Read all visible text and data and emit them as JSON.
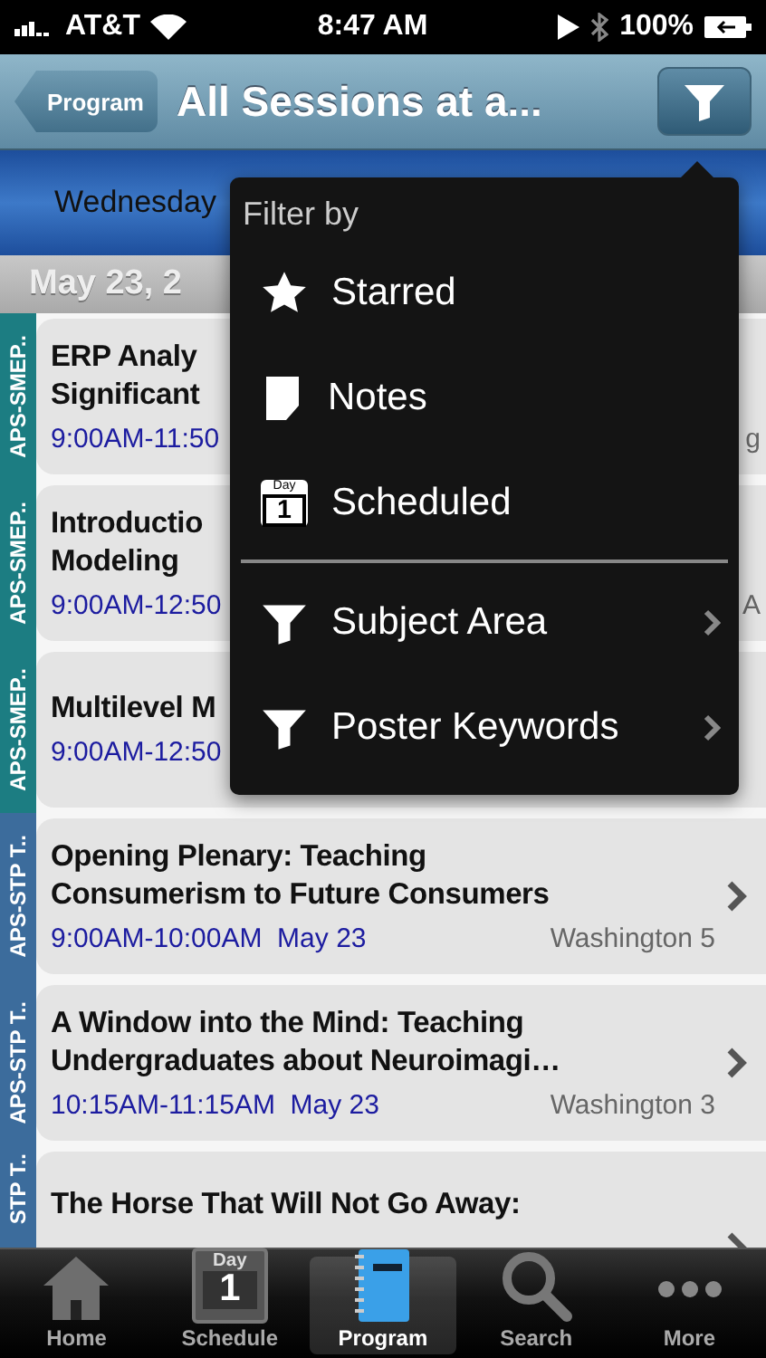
{
  "status_bar": {
    "carrier": "AT&T",
    "time": "8:47 AM",
    "battery": "100%"
  },
  "nav_bar": {
    "back": "Program",
    "title": "All Sessions at a..."
  },
  "day_strip": {
    "day": "Wednesday"
  },
  "date_header": "May 23, 2",
  "sessions": [
    {
      "tag": "APS-SMEP..",
      "color": "#1c7d82",
      "title_lines": [
        "ERP Analy",
        "Significant"
      ],
      "time": "9:00AM-11:50",
      "location": "g"
    },
    {
      "tag": "APS-SMEP..",
      "color": "#1c7d82",
      "title_lines": [
        "Introductio",
        "Modeling"
      ],
      "time": "9:00AM-12:50",
      "location": "A"
    },
    {
      "tag": "APS-SMEP..",
      "color": "#1c7d82",
      "title_lines": [
        "Multilevel M"
      ],
      "time": "9:00AM-12:50"
    },
    {
      "tag": "APS-STP T..",
      "color": "#3c6c9c",
      "title_lines": [
        "Opening Plenary: Teaching",
        "Consumerism to Future Consumers"
      ],
      "time": "9:00AM-10:00AM  May 23",
      "location": "Washington 5"
    },
    {
      "tag": "APS-STP T..",
      "color": "#3c6c9c",
      "title_lines": [
        "A Window into the Mind: Teaching",
        "Undergraduates about Neuroimagi…"
      ],
      "time": "10:15AM-11:15AM  May 23",
      "location": "Washington 3"
    },
    {
      "tag": "STP T..",
      "color": "#3c6c9c",
      "title_lines": [
        "The Horse That Will Not Go Away:"
      ]
    }
  ],
  "popover": {
    "heading": "Filter by",
    "groups": [
      [
        {
          "kind": "star",
          "label": "Starred",
          "submenu": false
        },
        {
          "kind": "note",
          "label": "Notes",
          "submenu": false
        },
        {
          "kind": "day",
          "label": "Scheduled",
          "icon_text": "Day",
          "icon_number": "1",
          "submenu": false
        }
      ],
      [
        {
          "kind": "filter",
          "label": "Subject Area",
          "submenu": true
        },
        {
          "kind": "filter",
          "label": "Poster Keywords",
          "submenu": true
        }
      ]
    ]
  },
  "tab_bar": [
    {
      "kind": "home",
      "label": "Home",
      "selected": false
    },
    {
      "kind": "day",
      "label": "Schedule",
      "selected": false,
      "icon_text": "Day",
      "icon_number": "1"
    },
    {
      "kind": "notebook",
      "label": "Program",
      "selected": true
    },
    {
      "kind": "search",
      "label": "Search",
      "selected": false
    },
    {
      "kind": "more",
      "label": "More",
      "selected": false
    }
  ]
}
